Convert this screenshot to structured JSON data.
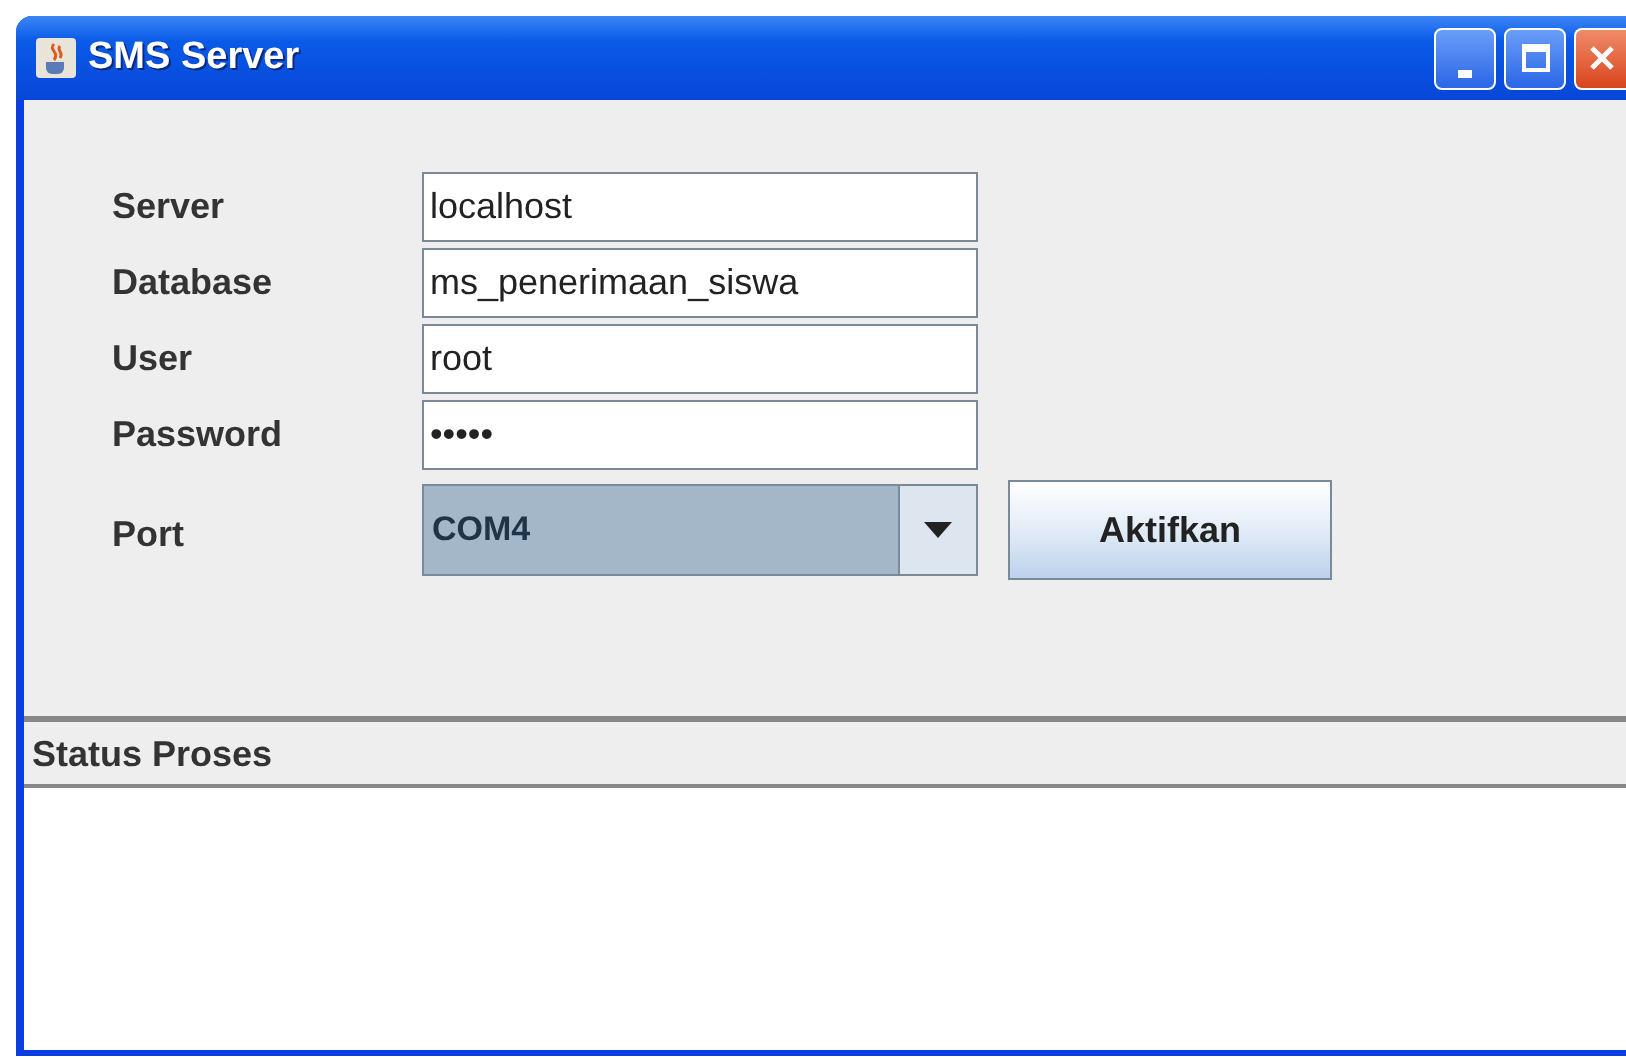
{
  "window": {
    "title": "SMS Server"
  },
  "fields": [
    {
      "label": "Server",
      "value": "localhost"
    },
    {
      "label": "Database",
      "value": "ms_penerimaan_siswa"
    },
    {
      "label": "User",
      "value": "root"
    },
    {
      "label": "Password",
      "value": "•••••"
    }
  ],
  "port": {
    "label": "Port",
    "value": "COM4"
  },
  "buttons": [
    "Aktifkan"
  ],
  "status_panel": {
    "title": "Status Proses"
  }
}
